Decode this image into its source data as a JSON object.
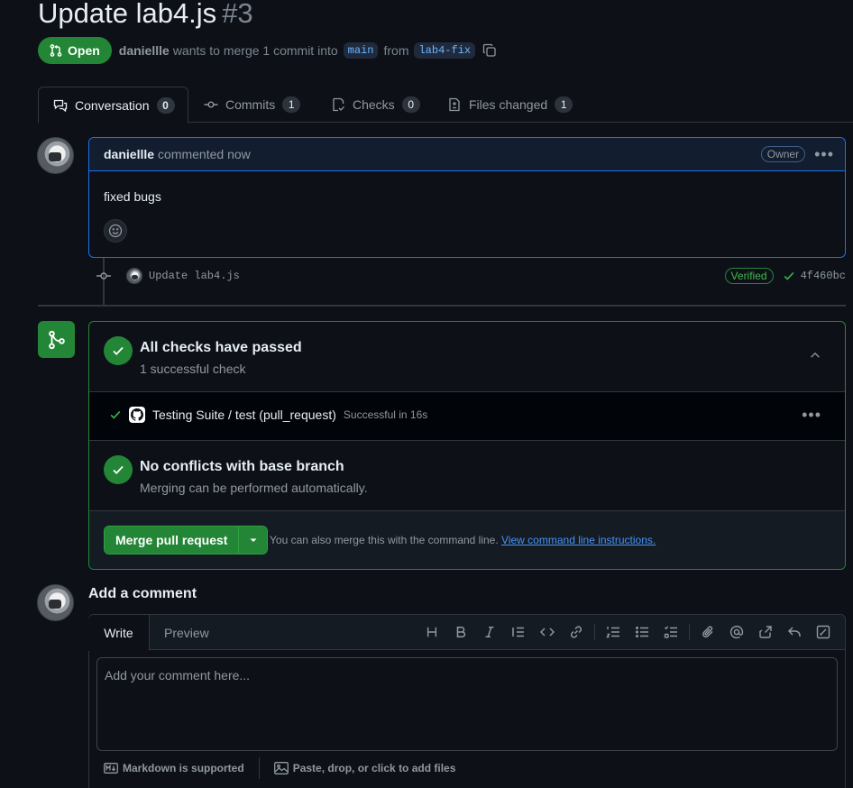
{
  "pr": {
    "title": "Update lab4.js",
    "number": "#3",
    "state": "Open",
    "author": "daniellle",
    "merge_text": "wants to merge 1 commit into",
    "base_branch": "main",
    "from_text": "from",
    "head_branch": "lab4-fix"
  },
  "tabs": [
    {
      "label": "Conversation",
      "count": "0",
      "icon": "comment-discussion-icon"
    },
    {
      "label": "Commits",
      "count": "1",
      "icon": "git-commit-icon"
    },
    {
      "label": "Checks",
      "count": "0",
      "icon": "checklist-icon"
    },
    {
      "label": "Files changed",
      "count": "1",
      "icon": "file-diff-icon"
    }
  ],
  "comment": {
    "author": "daniellle",
    "time": "commented now",
    "badge": "Owner",
    "body": "fixed bugs"
  },
  "commit": {
    "message": "Update lab4.js",
    "verified": "Verified",
    "sha": "4f460bc"
  },
  "merge_box": {
    "checks_title": "All checks have passed",
    "checks_sub": "1 successful check",
    "check_name": "Testing Suite / test (pull_request)",
    "check_status": "Successful in 16s",
    "conflicts_title": "No conflicts with base branch",
    "conflicts_sub": "Merging can be performed automatically.",
    "merge_button": "Merge pull request",
    "hint": "You can also merge this with the command line.",
    "hint_link": "View command line instructions."
  },
  "add_comment": {
    "title": "Add a comment",
    "write_tab": "Write",
    "preview_tab": "Preview",
    "placeholder": "Add your comment here...",
    "markdown_note": "Markdown is supported",
    "attach_note": "Paste, drop, or click to add files"
  },
  "colors": {
    "accent_green": "#238636",
    "accent_blue": "#1f6feb",
    "background": "#0d1117"
  }
}
